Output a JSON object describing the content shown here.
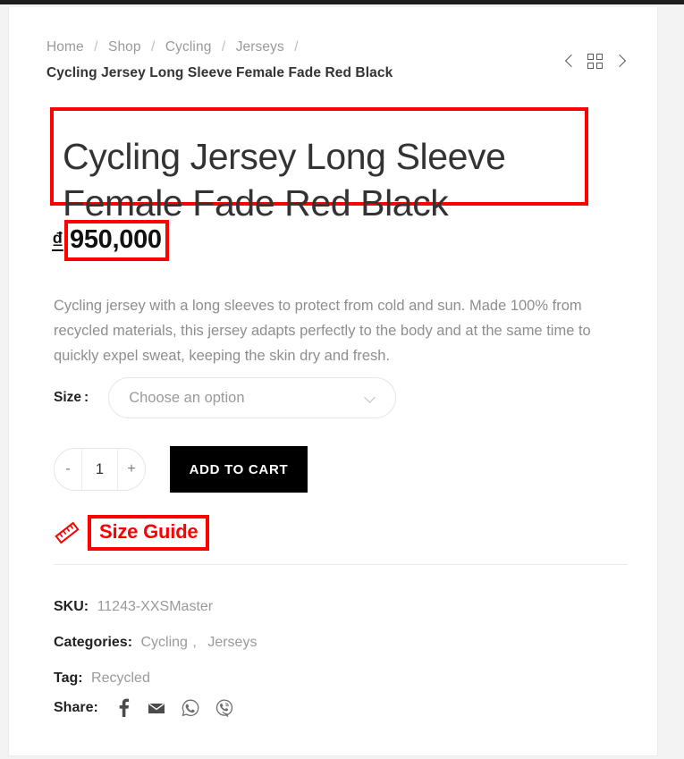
{
  "breadcrumb": {
    "items": [
      "Home",
      "Shop",
      "Cycling",
      "Jerseys"
    ],
    "separator": "/",
    "trailing_separator": "/",
    "current": "Cycling Jersey Long Sleeve Female Fade Red Black"
  },
  "nav": {
    "prev_icon": "chevron-left-icon",
    "grid_icon": "grid-view-icon",
    "next_icon": "chevron-right-icon"
  },
  "product": {
    "title": "Cycling Jersey Long Sleeve Female Fade Red Black",
    "currency_symbol": "₫",
    "price": "950,000",
    "description": "Cycling jersey with a long sleeves to protect from cold and sun. Made 100% from recycled materials, this jersey adapts perfectly to the body and at the same time to quickly expel sweat, keeping the skin dry and fresh."
  },
  "options": {
    "size_label": "Size",
    "size_colon": ":",
    "size_placeholder": "Choose an option"
  },
  "purchase": {
    "decrement": "-",
    "quantity": "1",
    "increment": "+",
    "add_to_cart": "ADD TO CART"
  },
  "size_guide": {
    "label": "Size Guide",
    "icon": "ruler-icon"
  },
  "meta": {
    "sku_key": "SKU:",
    "sku_value": "11243-XXSMaster",
    "categories_key": "Categories:",
    "categories": [
      "Cycling",
      "Jerseys"
    ],
    "categories_separator": ",",
    "tag_key": "Tag:",
    "tag_value": "Recycled"
  },
  "share": {
    "label": "Share:",
    "icons": [
      "facebook-icon",
      "email-icon",
      "whatsapp-icon",
      "viber-icon"
    ]
  },
  "colors": {
    "annotation_red": "#ff0000",
    "cart_button": "#000000",
    "text_dark": "#333333",
    "text_muted": "#9a9a9a",
    "page_background": "#f3f3f3"
  }
}
